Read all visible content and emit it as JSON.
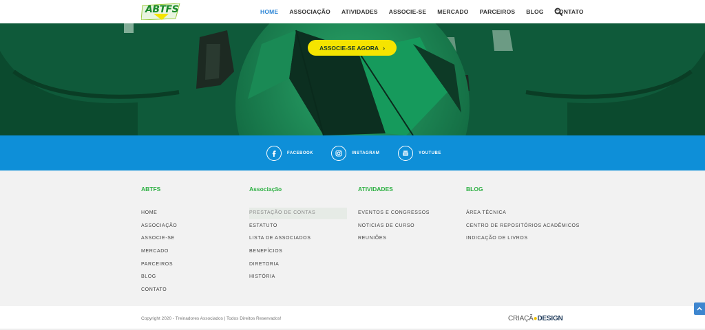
{
  "header": {
    "logo_text": "ABTFS",
    "nav": [
      "HOME",
      "ASSOCIAÇÃO",
      "ATIVIDADES",
      "ASSOCIE-SE",
      "MERCADO",
      "PARCEIROS",
      "BLOG",
      "CONTATO"
    ],
    "active": "HOME"
  },
  "hero": {
    "cta_label": "ASSOCIE-SE AGORA"
  },
  "social": [
    {
      "label": "FACEBOOK",
      "icon": "facebook-icon"
    },
    {
      "label": "INSTAGRAM",
      "icon": "instagram-icon"
    },
    {
      "label": "YOUTUBE",
      "icon": "youtube-icon"
    }
  ],
  "footer": {
    "columns": [
      {
        "title": "ABTFS",
        "links": [
          "HOME",
          "ASSOCIAÇÃO",
          "ASSOCIE-SE",
          "MERCADO",
          "PARCEIROS",
          "BLOG",
          "CONTATO"
        ]
      },
      {
        "title": "Associação",
        "links": [
          "PRESTAÇÃO DE CONTAS",
          "ESTATUTO",
          "LISTA DE ASSOCIADOS",
          "BENEFÍCIOS",
          "DIRETORIA",
          "HISTÓRIA"
        ]
      },
      {
        "title": "ATIVIDADES",
        "links": [
          "EVENTOS E CONGRESSOS",
          "NOTICIAS DE CURSO",
          "REUNIÕES"
        ]
      },
      {
        "title": "BLOG",
        "links": [
          "ÁREA TÉCNICA",
          "CENTRO DE REPOSITÓRIOS ACADÊMICOS",
          "INDICAÇÃO DE LIVROS"
        ]
      }
    ]
  },
  "bottom": {
    "copyright": "Copyright 2020 - Treinadores Associados | Todos Direitos Reservados!",
    "credit_left": "CRIAÇÃ",
    "credit_right": "DESIGN"
  },
  "colors": {
    "accent_blue": "#0e8fd8",
    "accent_green": "#2db043",
    "cta_yellow": "#f5e400",
    "nav_active": "#2e86d6"
  }
}
